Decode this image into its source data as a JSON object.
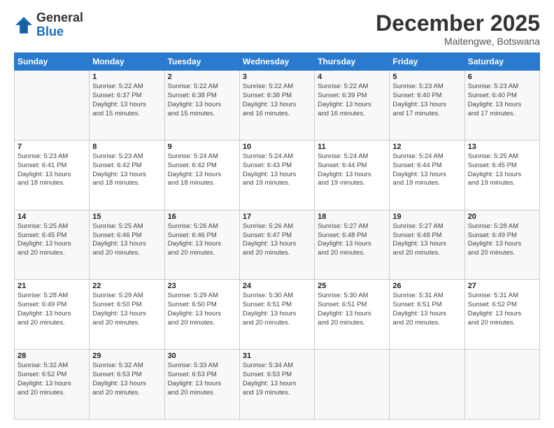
{
  "logo": {
    "general": "General",
    "blue": "Blue"
  },
  "header": {
    "month": "December 2025",
    "location": "Maitengwe, Botswana"
  },
  "weekdays": [
    "Sunday",
    "Monday",
    "Tuesday",
    "Wednesday",
    "Thursday",
    "Friday",
    "Saturday"
  ],
  "weeks": [
    [
      {
        "day": null,
        "info": null
      },
      {
        "day": "1",
        "info": "Sunrise: 5:22 AM\nSunset: 6:37 PM\nDaylight: 13 hours\nand 15 minutes."
      },
      {
        "day": "2",
        "info": "Sunrise: 5:22 AM\nSunset: 6:38 PM\nDaylight: 13 hours\nand 15 minutes."
      },
      {
        "day": "3",
        "info": "Sunrise: 5:22 AM\nSunset: 6:38 PM\nDaylight: 13 hours\nand 16 minutes."
      },
      {
        "day": "4",
        "info": "Sunrise: 5:22 AM\nSunset: 6:39 PM\nDaylight: 13 hours\nand 16 minutes."
      },
      {
        "day": "5",
        "info": "Sunrise: 5:23 AM\nSunset: 6:40 PM\nDaylight: 13 hours\nand 17 minutes."
      },
      {
        "day": "6",
        "info": "Sunrise: 5:23 AM\nSunset: 6:40 PM\nDaylight: 13 hours\nand 17 minutes."
      }
    ],
    [
      {
        "day": "7",
        "info": "Sunrise: 5:23 AM\nSunset: 6:41 PM\nDaylight: 13 hours\nand 18 minutes."
      },
      {
        "day": "8",
        "info": "Sunrise: 5:23 AM\nSunset: 6:42 PM\nDaylight: 13 hours\nand 18 minutes."
      },
      {
        "day": "9",
        "info": "Sunrise: 5:24 AM\nSunset: 6:42 PM\nDaylight: 13 hours\nand 18 minutes."
      },
      {
        "day": "10",
        "info": "Sunrise: 5:24 AM\nSunset: 6:43 PM\nDaylight: 13 hours\nand 19 minutes."
      },
      {
        "day": "11",
        "info": "Sunrise: 5:24 AM\nSunset: 6:44 PM\nDaylight: 13 hours\nand 19 minutes."
      },
      {
        "day": "12",
        "info": "Sunrise: 5:24 AM\nSunset: 6:44 PM\nDaylight: 13 hours\nand 19 minutes."
      },
      {
        "day": "13",
        "info": "Sunrise: 5:25 AM\nSunset: 6:45 PM\nDaylight: 13 hours\nand 19 minutes."
      }
    ],
    [
      {
        "day": "14",
        "info": "Sunrise: 5:25 AM\nSunset: 6:45 PM\nDaylight: 13 hours\nand 20 minutes."
      },
      {
        "day": "15",
        "info": "Sunrise: 5:25 AM\nSunset: 6:46 PM\nDaylight: 13 hours\nand 20 minutes."
      },
      {
        "day": "16",
        "info": "Sunrise: 5:26 AM\nSunset: 6:46 PM\nDaylight: 13 hours\nand 20 minutes."
      },
      {
        "day": "17",
        "info": "Sunrise: 5:26 AM\nSunset: 6:47 PM\nDaylight: 13 hours\nand 20 minutes."
      },
      {
        "day": "18",
        "info": "Sunrise: 5:27 AM\nSunset: 6:48 PM\nDaylight: 13 hours\nand 20 minutes."
      },
      {
        "day": "19",
        "info": "Sunrise: 5:27 AM\nSunset: 6:48 PM\nDaylight: 13 hours\nand 20 minutes."
      },
      {
        "day": "20",
        "info": "Sunrise: 5:28 AM\nSunset: 6:49 PM\nDaylight: 13 hours\nand 20 minutes."
      }
    ],
    [
      {
        "day": "21",
        "info": "Sunrise: 5:28 AM\nSunset: 6:49 PM\nDaylight: 13 hours\nand 20 minutes."
      },
      {
        "day": "22",
        "info": "Sunrise: 5:29 AM\nSunset: 6:50 PM\nDaylight: 13 hours\nand 20 minutes."
      },
      {
        "day": "23",
        "info": "Sunrise: 5:29 AM\nSunset: 6:50 PM\nDaylight: 13 hours\nand 20 minutes."
      },
      {
        "day": "24",
        "info": "Sunrise: 5:30 AM\nSunset: 6:51 PM\nDaylight: 13 hours\nand 20 minutes."
      },
      {
        "day": "25",
        "info": "Sunrise: 5:30 AM\nSunset: 6:51 PM\nDaylight: 13 hours\nand 20 minutes."
      },
      {
        "day": "26",
        "info": "Sunrise: 5:31 AM\nSunset: 6:51 PM\nDaylight: 13 hours\nand 20 minutes."
      },
      {
        "day": "27",
        "info": "Sunrise: 5:31 AM\nSunset: 6:52 PM\nDaylight: 13 hours\nand 20 minutes."
      }
    ],
    [
      {
        "day": "28",
        "info": "Sunrise: 5:32 AM\nSunset: 6:52 PM\nDaylight: 13 hours\nand 20 minutes."
      },
      {
        "day": "29",
        "info": "Sunrise: 5:32 AM\nSunset: 6:53 PM\nDaylight: 13 hours\nand 20 minutes."
      },
      {
        "day": "30",
        "info": "Sunrise: 5:33 AM\nSunset: 6:53 PM\nDaylight: 13 hours\nand 20 minutes."
      },
      {
        "day": "31",
        "info": "Sunrise: 5:34 AM\nSunset: 6:53 PM\nDaylight: 13 hours\nand 19 minutes."
      },
      {
        "day": null,
        "info": null
      },
      {
        "day": null,
        "info": null
      },
      {
        "day": null,
        "info": null
      }
    ]
  ]
}
